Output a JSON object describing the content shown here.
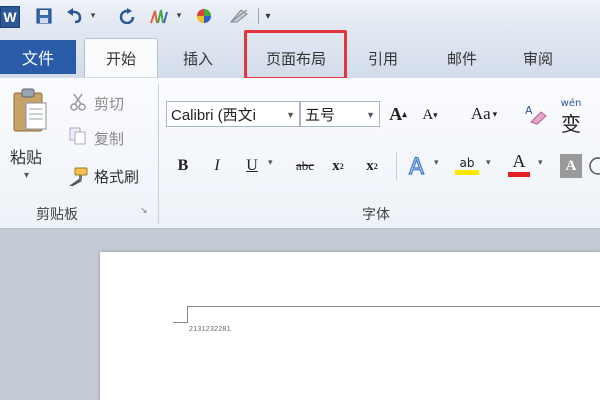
{
  "quick_access": {
    "app_logo": "W",
    "items": [
      "save-icon",
      "undo-icon",
      "redo-icon",
      "format-painter-icon",
      "color-icon",
      "clear-icon",
      "customize-icon"
    ]
  },
  "tabs": {
    "file": "文件",
    "home": "开始",
    "insert": "插入",
    "page_layout": "页面布局",
    "references": "引用",
    "mailings": "邮件",
    "review": "审阅"
  },
  "clipboard": {
    "paste": "粘贴",
    "cut": "剪切",
    "copy": "复制",
    "format_painter": "格式刷",
    "group_label": "剪贴板"
  },
  "font": {
    "font_name": "Calibri (西文i",
    "font_size": "五号",
    "group_label": "字体",
    "grow": "A",
    "shrink": "A",
    "case": "Aa",
    "bold": "B",
    "italic": "I",
    "underline": "U",
    "strike": "abc",
    "subscript": "x",
    "superscript": "x",
    "font_color": "A",
    "char_shade": "A",
    "highlight": "ab",
    "phonetic": "变"
  },
  "document": {
    "text": "2131232281"
  },
  "colors": {
    "file_tab": "#2a5ba8",
    "highlight_box": "#e5353c"
  }
}
